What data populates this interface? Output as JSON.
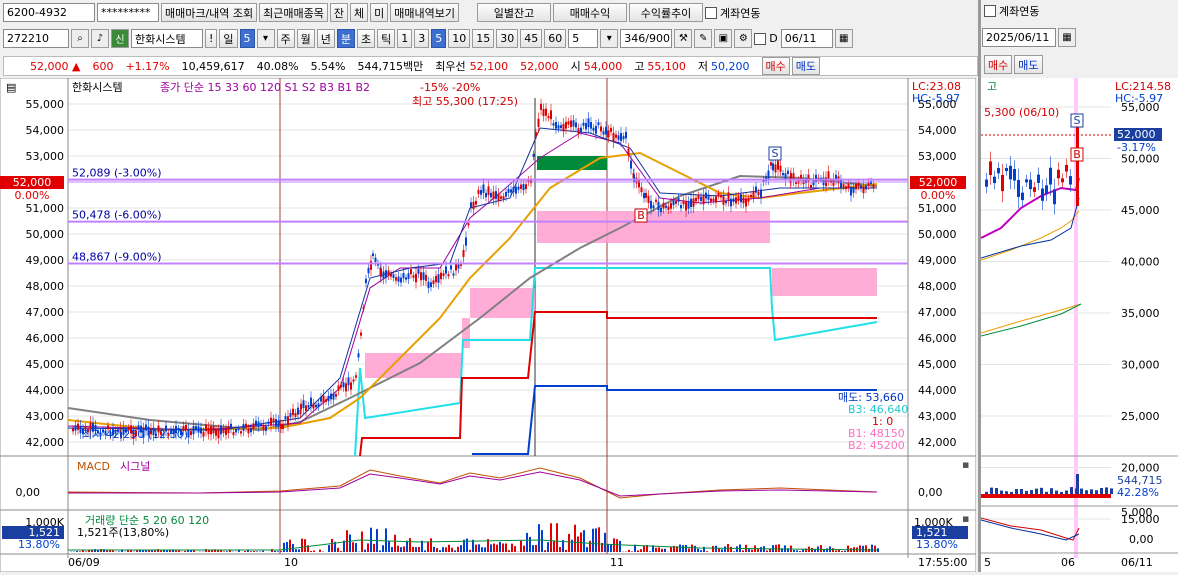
{
  "toolbar1": {
    "account": "6200-4932",
    "password": "*********",
    "buttons": [
      "매매마크/내역 조회",
      "최근매매종목",
      "잔",
      "체",
      "미",
      "매매내역보기"
    ],
    "buttons2": [
      "일별잔고",
      "매매수익",
      "수익률추이"
    ],
    "link_label": "계좌연동"
  },
  "toolbar2": {
    "code": "272210",
    "name": "한화시스템",
    "periods": [
      "일",
      "5"
    ],
    "units": [
      "주",
      "월",
      "년",
      "분",
      "초",
      "틱"
    ],
    "nums": [
      "1",
      "3",
      "5",
      "10",
      "15",
      "30",
      "45",
      "60"
    ],
    "count": "5",
    "range": "346/900",
    "date": "06/11",
    "d_label": "D"
  },
  "quote": {
    "price": "52,000 ▲",
    "change": "600",
    "pct": "+1.17%",
    "volume": "10,459,617",
    "ratio": "40.08%",
    "rate": "5.54%",
    "amount": "544,715백만",
    "best_label": "최우선",
    "best1": "52,100",
    "best2": "52,000",
    "open_label": "시",
    "open": "54,000",
    "high_label": "고",
    "high": "55,100",
    "low_label": "저",
    "low": "50,200",
    "buy": "매수",
    "sell": "매도"
  },
  "chart": {
    "legend": {
      "name": "한화시스템",
      "ma": "종가 단순 15 33 60 120 S1 S2 B3 B1 B2",
      "pct": "-15% -20%"
    },
    "lc": "LC:23.08",
    "hc": "HC:-5.97",
    "high_note": "최고 55,300 (17:25)",
    "low_note": "최저 42,250 (12:30)",
    "price_ticks": [
      "55,000",
      "54,000",
      "53,000",
      "52,000",
      "51,000",
      "50,000",
      "49,000",
      "48,000",
      "47,000",
      "46,000",
      "45,000",
      "44,000",
      "43,000",
      "42,000"
    ],
    "current": "52,000",
    "current_pct": "0.00%",
    "levels": [
      {
        "label": "52,089 (-3.00%)",
        "price": 52089
      },
      {
        "label": "50,478 (-6.00%)",
        "price": 50478
      },
      {
        "label": "48,867 (-9.00%)",
        "price": 48867
      }
    ],
    "sell_info": [
      "매도: 53,660",
      "B3: 46,640",
      "1: 0",
      "B1: 48150",
      "B2: 45200"
    ],
    "macd_label": "MACD",
    "signal_label": "시그널",
    "macd_tick": "0,00",
    "vol_legend": "거래량 단순 5 20 60 120",
    "vol_value": "1,521주(13,80%)",
    "vol_tick": "1,000K",
    "vol_side": "1,521",
    "vol_side_pct": "13.80%",
    "dates": [
      "06/09",
      "10",
      "11"
    ],
    "time": "17:55:00",
    "markers": [
      "S",
      "B"
    ]
  },
  "right": {
    "link": "계좌연동",
    "date": "2025/06/11",
    "buy": "매수",
    "sell": "매도",
    "tab": "고",
    "lc": "LC:214.58",
    "hc": "HC:-5.97",
    "high_note": "5,300 (06/10)",
    "current": "52,000",
    "current_pct": "-3.17%",
    "ticks": [
      "55,000",
      "50,000",
      "45,000",
      "40,000",
      "35,000",
      "30,000",
      "25,000",
      "20,000",
      "15,000"
    ],
    "vol_val": "544,715",
    "vol_pct": "42.28%",
    "vol_ticks": [
      "5,000",
      "0,00"
    ],
    "dates": [
      "5",
      "06",
      "06/11"
    ]
  },
  "colors": {
    "up": "#e00000",
    "down": "#0040d0",
    "ma_orange": "#e8a000",
    "ma_gray": "#808080",
    "ma_purple": "#a000a0",
    "cyan": "#20e0e8",
    "pink": "#ff9ed0",
    "green": "#008a3a",
    "level": "#c080ff"
  }
}
